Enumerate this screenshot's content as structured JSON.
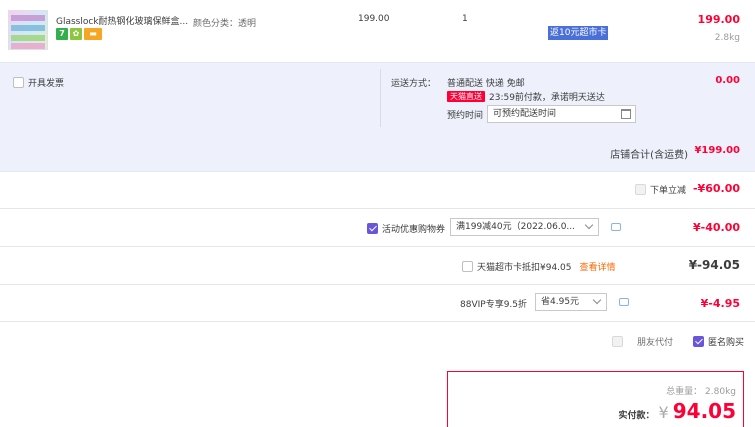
{
  "product": {
    "title": "Glasslock耐热钢化玻璃保鲜盒...",
    "spec": "颜色分类：透明",
    "unit_price": "199.00",
    "quantity": "1",
    "coupon_button": "返10元超市卡",
    "subtotal": "199.00",
    "weight": "2.8kg",
    "badges": [
      "7",
      "✿",
      "▬"
    ]
  },
  "shipping": {
    "invoice_label": "开具发票",
    "method_label": "运送方式：",
    "method_value": "普通配送 快递 免邮",
    "tmall_tag": "天猫直送",
    "delivery_note": "23:59前付款，承诺明天送达",
    "appoint_label": "预约时间",
    "appoint_placeholder": "可预约配送时间",
    "fee": "0.00"
  },
  "store_total": {
    "label": "店铺合计(含运费)",
    "value": "¥199.00"
  },
  "discounts": {
    "order_discount": {
      "label": "下单立减",
      "value": "-¥60.00"
    },
    "activity_coupon": {
      "label": "活动优惠购物券",
      "selected": "满199减40元（2022.06.0...",
      "value": "¥-40.00"
    },
    "supermarket_card": {
      "label": "天猫超市卡抵扣¥94.05",
      "link": "查看详情",
      "value": "¥-94.05"
    },
    "vip": {
      "label": "88VIP专享9.5折",
      "selected": "省4.95元",
      "value": "¥-4.95"
    }
  },
  "options": {
    "friend_pay": "朋友代付",
    "anonymous": "匿名购买"
  },
  "payment": {
    "weight_label": "总重量：",
    "weight_value": "2.80kg",
    "paid_label": "实付款：",
    "currency": "¥",
    "amount": "94.05"
  },
  "colors": {
    "accent": "#ff0036",
    "purple": "#6a56d8",
    "bg_block": "#eef1fb"
  }
}
